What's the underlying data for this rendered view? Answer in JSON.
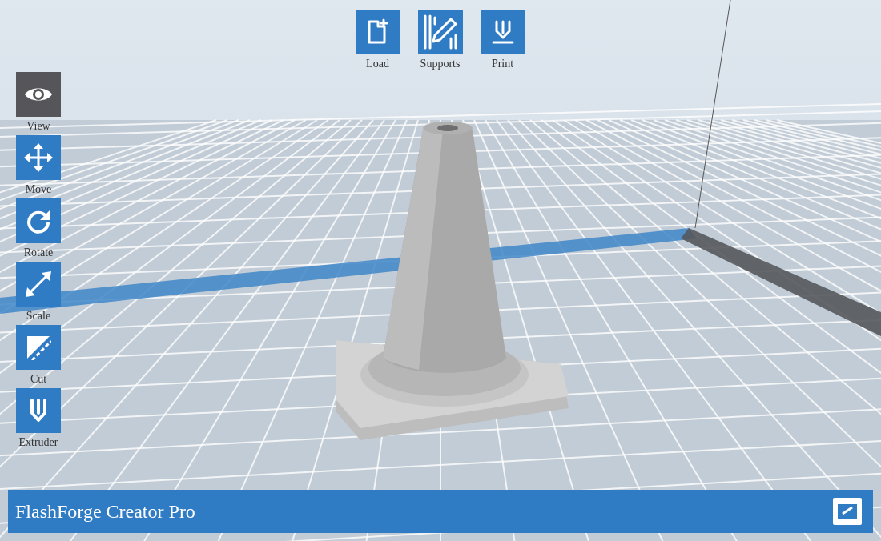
{
  "top_toolbar": [
    {
      "label": "Load",
      "selected": false
    },
    {
      "label": "Supports",
      "selected": false
    },
    {
      "label": "Print",
      "selected": false
    }
  ],
  "left_toolbar": [
    {
      "label": "View",
      "selected": true
    },
    {
      "label": "Move",
      "selected": false
    },
    {
      "label": "Rotate",
      "selected": false
    },
    {
      "label": "Scale",
      "selected": false
    },
    {
      "label": "Cut",
      "selected": false
    },
    {
      "label": "Extruder",
      "selected": false
    }
  ],
  "status_bar": {
    "printer": "FlashForge Creator Pro"
  }
}
